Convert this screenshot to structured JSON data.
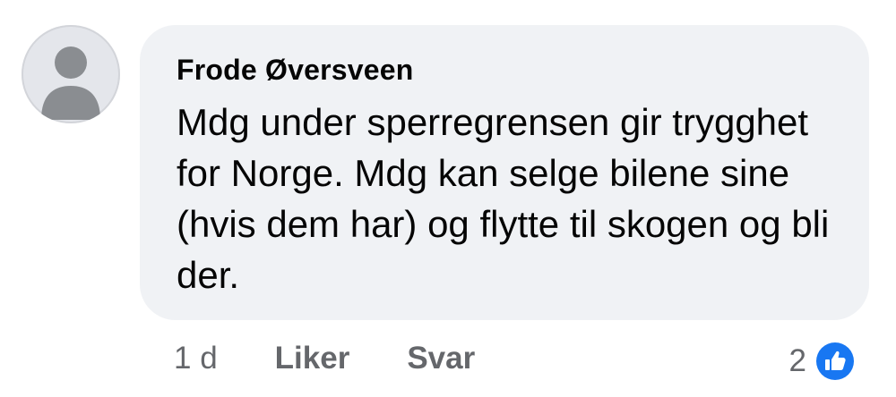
{
  "comment": {
    "author": "Frode Øversveen",
    "text": "Mdg under sperregrensen gir trygghet for Norge. Mdg kan selge bilene sine (hvis dem har) og flytte til skogen og bli der.",
    "avatar_icon": "default-avatar-icon"
  },
  "actions": {
    "time": "1 d",
    "like_label": "Liker",
    "reply_label": "Svar"
  },
  "reactions": {
    "count": "2",
    "icon": "like-reaction-icon",
    "color": "#1877f2"
  },
  "colors": {
    "bubble": "#f0f2f5",
    "secondary_text": "#65676b",
    "primary_text": "#050505"
  }
}
